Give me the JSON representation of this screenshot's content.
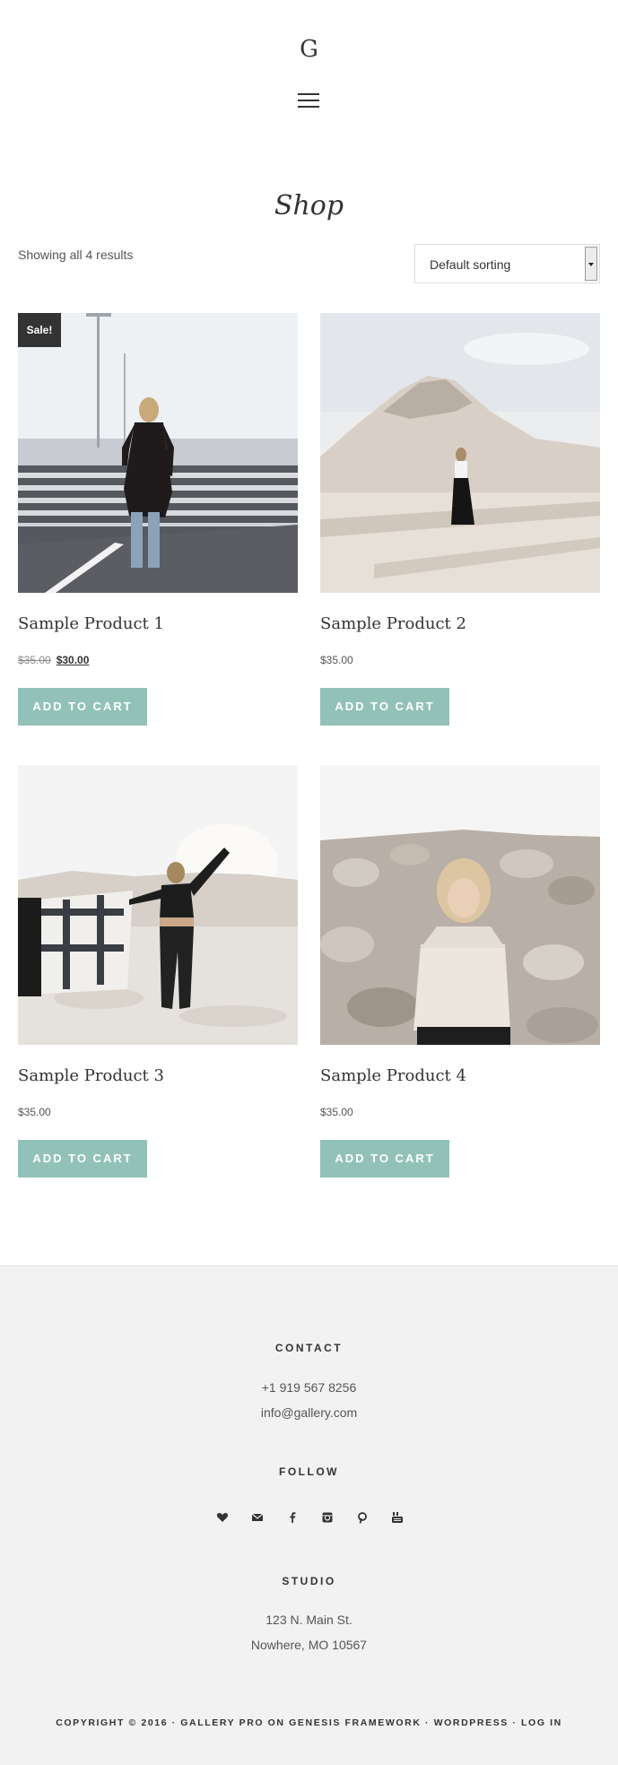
{
  "header": {
    "logo": "G"
  },
  "shop": {
    "title": "Shop",
    "result_count": "Showing all 4 results",
    "sort_selected": "Default sorting"
  },
  "products": [
    {
      "name": "Sample Product 1",
      "badge": "Sale!",
      "regular_price": "$35.00",
      "sale_price": "$30.00",
      "price": "",
      "button": "ADD TO CART"
    },
    {
      "name": "Sample Product 2",
      "price": "$35.00",
      "button": "ADD TO CART"
    },
    {
      "name": "Sample Product 3",
      "price": "$35.00",
      "button": "ADD TO CART"
    },
    {
      "name": "Sample Product 4",
      "price": "$35.00",
      "button": "ADD TO CART"
    }
  ],
  "footer": {
    "contact": {
      "heading": "CONTACT",
      "phone": "+1 919 567 8256",
      "email": "info@gallery.com"
    },
    "follow": {
      "heading": "FOLLOW",
      "icons": [
        "heart-icon",
        "email-icon",
        "facebook-icon",
        "instagram-icon",
        "pinterest-icon",
        "youtube-icon"
      ]
    },
    "studio": {
      "heading": "STUDIO",
      "address_line1": "123 N. Main St.",
      "address_line2": "Nowhere, MO 10567"
    },
    "copyright": {
      "prefix": "COPYRIGHT © 2016 · ",
      "theme_link": "GALLERY PRO",
      "on": " ON ",
      "framework_link": "GENESIS FRAMEWORK",
      "sep1": " · ",
      "wordpress_link": "WORDPRESS",
      "sep2": " · ",
      "login_link": "LOG IN"
    }
  },
  "colors": {
    "accent": "#92c2b7",
    "footer_bg": "#f2f2f2",
    "badge_bg": "#333333",
    "text": "#333333"
  }
}
